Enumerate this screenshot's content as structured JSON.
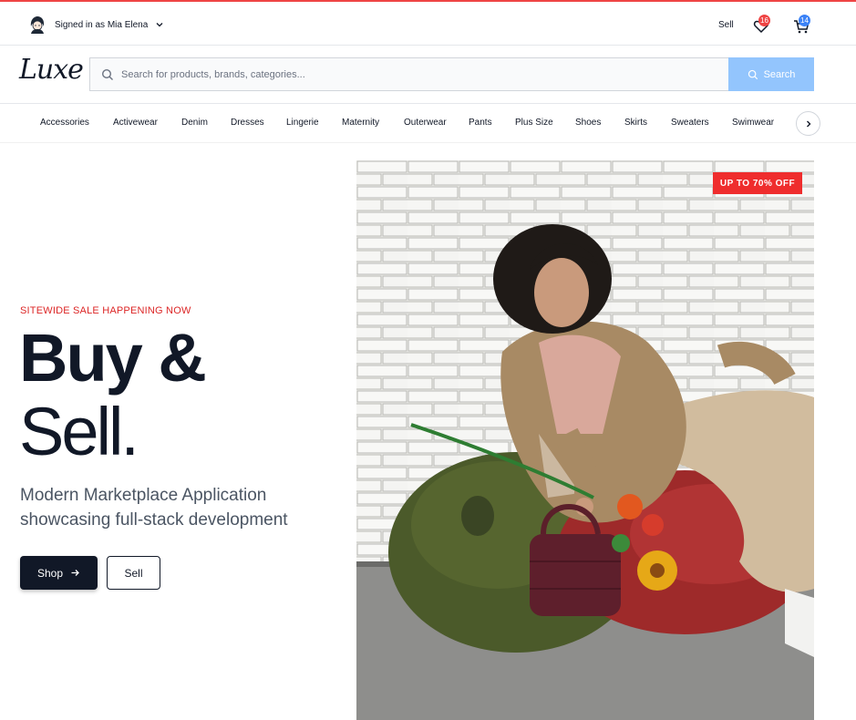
{
  "topbar": {
    "account_label": "Signed in as Mia Elena",
    "sell_label": "Sell",
    "wishlist_count": "16",
    "cart_count": "14",
    "accent_color": "#ef4444"
  },
  "brand": {
    "logo_text": "Luxe"
  },
  "search": {
    "placeholder": "Search for products, brands, categories...",
    "value": "",
    "button_label": "Search"
  },
  "categories": [
    "Accessories",
    "Activewear",
    "Denim",
    "Dresses",
    "Lingerie",
    "Maternity",
    "Outerwear",
    "Pants",
    "Plus Size",
    "Shoes",
    "Skirts",
    "Sweaters",
    "Swimwear"
  ],
  "hero": {
    "eyebrow": "SITEWIDE SALE HAPPENING NOW",
    "title_line1": "Buy &",
    "title_line2": "Sell.",
    "subtitle_line1": "Modern Marketplace Application",
    "subtitle_line2": "showcasing full-stack development",
    "shop_label": "Shop",
    "sell_label": "Sell",
    "sale_tag": "UP TO 70% OFF"
  },
  "icons": [
    "avatar-icon",
    "chevron-down-icon",
    "heart-icon",
    "cart-icon",
    "search-icon",
    "arrow-right-icon",
    "chevron-right-icon"
  ]
}
